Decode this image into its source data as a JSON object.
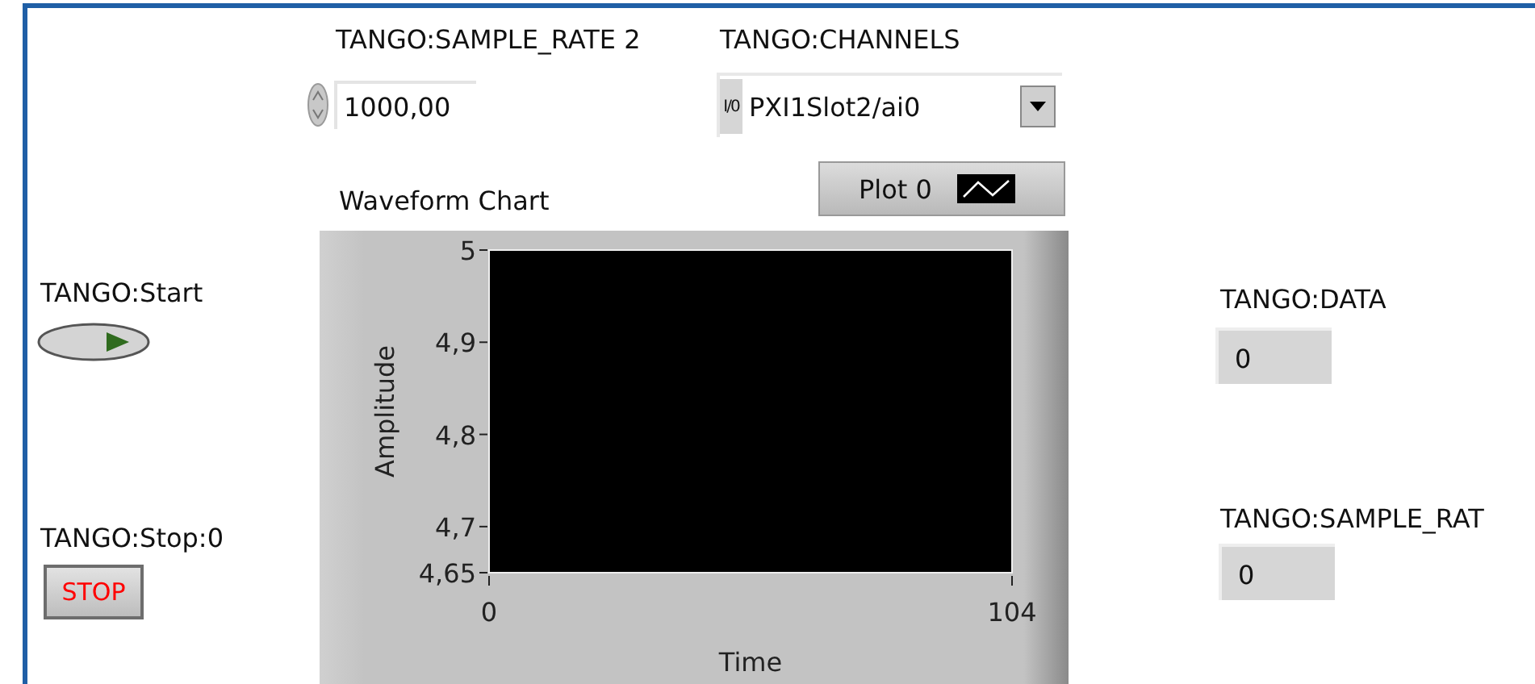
{
  "panel": {
    "sample_rate_control": {
      "label": "TANGO:SAMPLE_RATE 2",
      "value": "1000,00"
    },
    "channels_control": {
      "label": "TANGO:CHANNELS",
      "io_glyph": "I/0",
      "value": "PXI1Slot2/ai0"
    },
    "start_button": {
      "label": "TANGO:Start",
      "on": false
    },
    "stop_button": {
      "label": "TANGO:Stop:0",
      "caption": "STOP",
      "pressed": false
    },
    "chart": {
      "label": "Waveform Chart",
      "legend": {
        "plot_name": "Plot 0"
      },
      "chart_data": {
        "type": "line",
        "xlabel": "Time",
        "ylabel": "Amplitude",
        "xlim": [
          0,
          104
        ],
        "ylim": [
          4.65,
          5
        ],
        "xticks": [
          0,
          104
        ],
        "yticks": [
          {
            "value": 4.65,
            "label": "4,65"
          },
          {
            "value": 4.7,
            "label": "4,7"
          },
          {
            "value": 4.8,
            "label": "4,8"
          },
          {
            "value": 4.9,
            "label": "4,9"
          },
          {
            "value": 5,
            "label": "5"
          }
        ]
      }
    },
    "indicators": [
      {
        "label": "TANGO:DATA",
        "value": "0"
      },
      {
        "label": "TANGO:SAMPLE_RAT",
        "value": "0"
      }
    ]
  }
}
